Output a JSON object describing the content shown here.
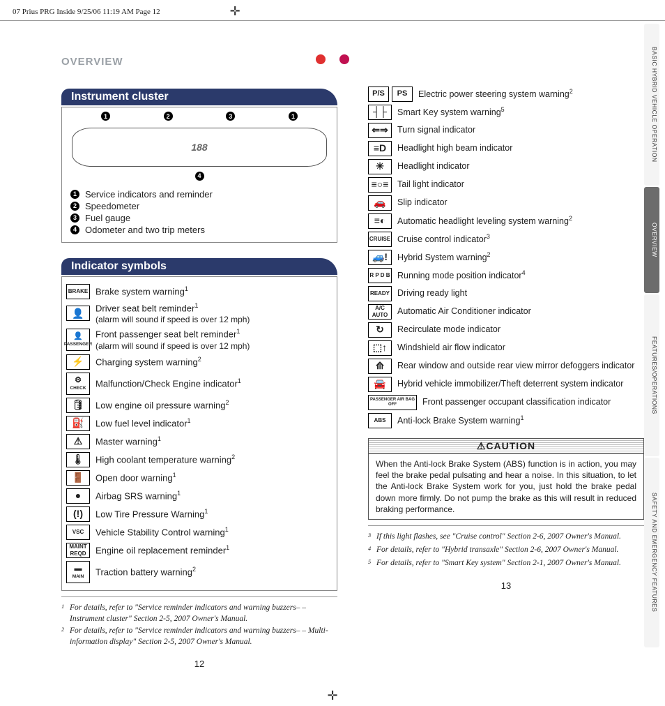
{
  "print_header": "07 Prius PRG Inside  9/25/06  11:19 AM  Page 12",
  "overview_label": "OVERVIEW",
  "section_cluster": "Instrument cluster",
  "section_symbols": "Indicator symbols",
  "callouts": {
    "c1": "Service indicators and reminder",
    "c2": "Speedometer",
    "c3": "Fuel gauge",
    "c4": "Odometer and two trip meters"
  },
  "cluster_sample": "188",
  "left_indicators": [
    {
      "icon_text": "BRAKE",
      "name": "indicator-brake",
      "desc": "Brake system warning",
      "sup": "1"
    },
    {
      "icon_glyph": "👤",
      "name": "indicator-driver-seatbelt",
      "desc": "Driver seat belt reminder",
      "sup": "1",
      "sub": "(alarm will sound if speed is over 12 mph)"
    },
    {
      "icon_text": "PASSENGER",
      "tall": true,
      "glyph_top": "👤",
      "name": "indicator-passenger-seatbelt",
      "desc": "Front passenger seat belt reminder",
      "sup": "1",
      "sub": "(alarm will sound if speed is over 12 mph)"
    },
    {
      "icon_glyph": "⚡",
      "name": "indicator-charging",
      "desc": "Charging system warning",
      "sup": "2"
    },
    {
      "icon_text": "CHECK",
      "glyph_top": "⚙",
      "tall": true,
      "name": "indicator-check-engine",
      "desc": "Malfunction/Check Engine indicator",
      "sup": "1"
    },
    {
      "icon_glyph": "🛢",
      "name": "indicator-oil-pressure",
      "desc": "Low engine oil pressure warning",
      "sup": "2"
    },
    {
      "icon_glyph": "⛽",
      "name": "indicator-low-fuel",
      "desc": "Low fuel level indicator",
      "sup": "1"
    },
    {
      "icon_glyph": "⚠",
      "name": "indicator-master-warning",
      "desc": "Master warning",
      "sup": "1"
    },
    {
      "icon_glyph": "🌡",
      "name": "indicator-coolant",
      "desc": "High coolant temperature warning",
      "sup": "2"
    },
    {
      "icon_glyph": "🚪",
      "name": "indicator-door",
      "desc": "Open door warning",
      "sup": "1"
    },
    {
      "icon_glyph": "●",
      "name": "indicator-airbag",
      "desc": "Airbag SRS warning",
      "sup": "1"
    },
    {
      "icon_glyph": "(!)",
      "name": "indicator-tire-pressure",
      "desc": "Low Tire Pressure Warning",
      "sup": "1"
    },
    {
      "icon_text": "VSC",
      "name": "indicator-vsc",
      "desc": "Vehicle Stability Control warning",
      "sup": "1"
    },
    {
      "icon_text": "MAINT REQD",
      "name": "indicator-maint-reqd",
      "desc": "Engine oil replacement reminder",
      "sup": "1"
    },
    {
      "icon_text": "MAIN",
      "glyph_top": "▬",
      "tall": true,
      "name": "indicator-traction-battery",
      "desc": "Traction battery warning",
      "sup": "2"
    }
  ],
  "right_indicators": [
    {
      "double": [
        "P/S",
        "PS"
      ],
      "name": "indicator-power-steering",
      "desc": "Electric power steering system warning",
      "sup": "2"
    },
    {
      "icon_glyph": "┤├",
      "name": "indicator-smart-key",
      "desc": "Smart Key system warning",
      "sup": "5"
    },
    {
      "icon_glyph": "⇐⇒",
      "name": "indicator-turn-signal",
      "desc": "Turn signal indicator"
    },
    {
      "icon_glyph": "≡D",
      "name": "indicator-high-beam",
      "desc": "Headlight high beam indicator"
    },
    {
      "icon_glyph": "☀",
      "name": "indicator-headlight",
      "desc": "Headlight indicator"
    },
    {
      "icon_glyph": "≡○≡",
      "name": "indicator-tail-light",
      "desc": "Tail light indicator"
    },
    {
      "icon_glyph": "🚗",
      "name": "indicator-slip",
      "desc": "Slip indicator"
    },
    {
      "icon_glyph": "≡◐",
      "name": "indicator-auto-leveling",
      "desc": "Automatic headlight leveling system warning",
      "sup": "2"
    },
    {
      "icon_text": "CRUISE",
      "name": "indicator-cruise",
      "desc": "Cruise control indicator",
      "sup": "3"
    },
    {
      "icon_glyph": "🚙!",
      "name": "indicator-hybrid-warning",
      "desc": "Hybrid System warning",
      "sup": "2"
    },
    {
      "icon_text": "R P D B",
      "name": "indicator-running-mode",
      "desc": "Running mode position indicator",
      "sup": "4"
    },
    {
      "icon_text": "READY",
      "name": "indicator-ready",
      "desc": "Driving ready light"
    },
    {
      "icon_text": "A/C AUTO",
      "name": "indicator-ac-auto",
      "desc": "Automatic Air Conditioner indicator"
    },
    {
      "icon_glyph": "↻",
      "name": "indicator-recirculate",
      "desc": "Recirculate mode indicator"
    },
    {
      "icon_glyph": "⬚↑",
      "name": "indicator-windshield",
      "desc": "Windshield air flow indicator"
    },
    {
      "icon_glyph": "⟰",
      "name": "indicator-rear-defog",
      "desc": "Rear window and outside rear view mirror defoggers indicator"
    },
    {
      "icon_glyph": "🚘",
      "name": "indicator-immobilizer",
      "desc": "Hybrid vehicle immobilizer/Theft deterrent system indicator"
    },
    {
      "icon_text": "PASSENGER AIR BAG OFF",
      "wide": true,
      "name": "indicator-passenger-airbag-off",
      "desc": "Front passenger occupant classification indicator"
    },
    {
      "icon_text": "ABS",
      "name": "indicator-abs",
      "desc": "Anti-lock Brake System warning",
      "sup": "1"
    }
  ],
  "caution_label": "⚠CAUTION",
  "caution_body": "When the Anti-lock Brake System (ABS) function is in action, you may feel the brake pedal pulsating and hear a noise. In this situation, to let the Anti-lock Brake System work for you, just hold the brake pedal down more firmly. Do not pump the brake as this will result in reduced braking performance.",
  "footnotes_left": [
    {
      "n": "1",
      "t": "For details, refer to \"Service reminder indicators and warning buzzers– – Instrument cluster\" Section 2-5, 2007 Owner's Manual."
    },
    {
      "n": "2",
      "t": "For details, refer to \"Service reminder indicators and warning buzzers– – Multi-information display\" Section 2-5, 2007 Owner's Manual."
    }
  ],
  "footnotes_right": [
    {
      "n": "3",
      "t": "If this light flashes, see \"Cruise control\" Section 2-6, 2007 Owner's Manual."
    },
    {
      "n": "4",
      "t": "For details, refer to \"Hybrid transaxle\" Section 2-6, 2007 Owner's Manual."
    },
    {
      "n": "5",
      "t": "For details, refer to \"Smart Key system\" Section 2-1, 2007 Owner's Manual."
    }
  ],
  "page_left": "12",
  "page_right": "13",
  "tabs": {
    "t1": "BASIC HYBRID VEHICLE OPERATION",
    "t2": "OVERVIEW",
    "t3": "FEATURES/OPERATIONS",
    "t4": "SAFETY AND EMERGENCY FEATURES"
  }
}
